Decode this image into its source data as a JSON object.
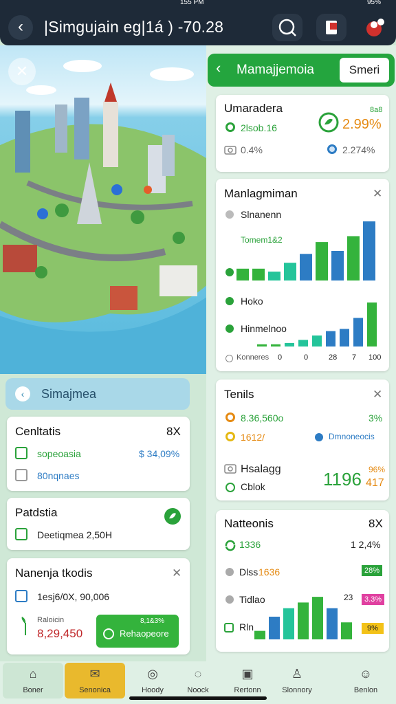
{
  "status": {
    "time": "155 PM",
    "battery": "95%"
  },
  "header": {
    "back_icon": "arrow-left-icon",
    "title": "|Simgujain eg|1á )  -70.28"
  },
  "right_panel": {
    "title": "Mamajjemoia",
    "button_label": "Smeri"
  },
  "card1": {
    "title": "Umaradera",
    "badge": "8a8",
    "row1_value": "2lsob.16",
    "row1_pct": "2.99%",
    "row2_value": "0.4%",
    "row2_pct": "2.274%"
  },
  "card2": {
    "title": "Manlagmiman",
    "legend": [
      "Slnanenn",
      "Tomem1&2",
      "Hoko",
      "Hinmelnoo",
      "Konneres"
    ],
    "axis": [
      "0",
      "0",
      "28",
      "7",
      "100"
    ],
    "chart_data": [
      {
        "type": "bar",
        "values": [
          20,
          20,
          15,
          30,
          45,
          65,
          50,
          75,
          100
        ]
      },
      {
        "type": "bar",
        "values": [
          5,
          5,
          8,
          15,
          25,
          35,
          40,
          65,
          100
        ]
      }
    ]
  },
  "card3": {
    "title": "Tenils",
    "row1": "8.36,560o",
    "row1_pct": "3%",
    "row2": "1612/",
    "row2_right": "Dmnoneocis",
    "row3": "Hsalagg",
    "row3_sub": "Cblok",
    "big_value": "1196",
    "small1": "96%",
    "small2": "417"
  },
  "card4": {
    "title": "Natteonis",
    "badge": "8X",
    "row1": "1336",
    "row1_pct": "1 2,4%",
    "row2": "Dlss",
    "row2_hl": "1636",
    "row2_badge": "28%",
    "row3": "Tidlao",
    "row3_val": "23",
    "row3_badge": "3.3%",
    "row4": "Rln",
    "row4_badge": "9%",
    "chart_data": {
      "type": "bar",
      "values": [
        15,
        40,
        55,
        65,
        75,
        55,
        30
      ]
    }
  },
  "left_panel": {
    "title": "Simajmea"
  },
  "lcard1": {
    "title": "Cenltatis",
    "badge": "8X",
    "row1": "sopeoasia",
    "row1_pct": "$ 34,09%",
    "row2": "80nqnaes"
  },
  "lcard2": {
    "title": "Patdstia",
    "row1": "Deetiqmea 2,50H"
  },
  "lcard3": {
    "title": "Nanenja tkodis",
    "row1": "1esj6/0X, 90,006",
    "row2_label": "Raloicin",
    "row2_value": "8,29,450",
    "button_top": "8,1&3%",
    "button_label": "Rehaopeore"
  },
  "nav": [
    {
      "label": "Boner",
      "icon": "home-icon"
    },
    {
      "label": "Senonica",
      "icon": "gift-icon"
    },
    {
      "label": "Hoody",
      "icon": "compass-icon"
    },
    {
      "label": "Noock",
      "icon": "chat-icon"
    },
    {
      "label": "Rertonn",
      "icon": "document-icon"
    },
    {
      "label": "Slonnory",
      "icon": "person-icon"
    },
    {
      "label": "Benlon",
      "icon": "user-icon"
    }
  ],
  "colors": {
    "accent": "#24a53e",
    "header": "#1e2a38",
    "bar_blue": "#2d7cc4",
    "bar_teal": "#24c49a",
    "bar_green": "#34b33c"
  }
}
